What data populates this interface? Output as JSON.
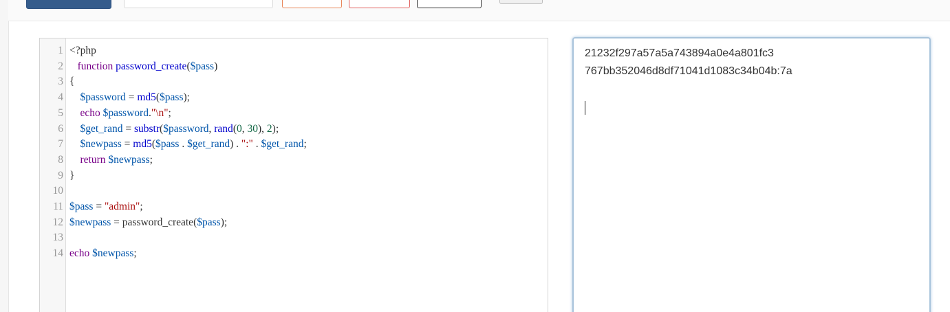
{
  "editor": {
    "lines": [
      {
        "n": "1",
        "tokens": [
          [
            "plain",
            "<?php"
          ]
        ]
      },
      {
        "n": "2",
        "tokens": [
          [
            "plain",
            "   "
          ],
          [
            "kw",
            "function"
          ],
          [
            "plain",
            " "
          ],
          [
            "fn",
            "password_create"
          ],
          [
            "plain",
            "("
          ],
          [
            "var",
            "$pass"
          ],
          [
            "plain",
            ")"
          ]
        ]
      },
      {
        "n": "3",
        "tokens": [
          [
            "plain",
            "{"
          ]
        ]
      },
      {
        "n": "4",
        "tokens": [
          [
            "plain",
            "    "
          ],
          [
            "var",
            "$password"
          ],
          [
            "plain",
            " = "
          ],
          [
            "fn",
            "md5"
          ],
          [
            "plain",
            "("
          ],
          [
            "var",
            "$pass"
          ],
          [
            "plain",
            ");"
          ]
        ]
      },
      {
        "n": "5",
        "tokens": [
          [
            "plain",
            "    "
          ],
          [
            "kw",
            "echo"
          ],
          [
            "plain",
            " "
          ],
          [
            "var",
            "$password"
          ],
          [
            "plain",
            "."
          ],
          [
            "str",
            "\"\\n\""
          ],
          [
            "plain",
            ";"
          ]
        ]
      },
      {
        "n": "6",
        "tokens": [
          [
            "plain",
            "    "
          ],
          [
            "var",
            "$get_rand"
          ],
          [
            "plain",
            " = "
          ],
          [
            "fn",
            "substr"
          ],
          [
            "plain",
            "("
          ],
          [
            "var",
            "$password"
          ],
          [
            "plain",
            ", "
          ],
          [
            "fn",
            "rand"
          ],
          [
            "plain",
            "("
          ],
          [
            "num",
            "0"
          ],
          [
            "plain",
            ", "
          ],
          [
            "num",
            "30"
          ],
          [
            "plain",
            "), "
          ],
          [
            "num",
            "2"
          ],
          [
            "plain",
            ");"
          ]
        ]
      },
      {
        "n": "7",
        "tokens": [
          [
            "plain",
            "    "
          ],
          [
            "var",
            "$newpass"
          ],
          [
            "plain",
            " = "
          ],
          [
            "fn",
            "md5"
          ],
          [
            "plain",
            "("
          ],
          [
            "var",
            "$pass"
          ],
          [
            "plain",
            " . "
          ],
          [
            "var",
            "$get_rand"
          ],
          [
            "plain",
            ") . "
          ],
          [
            "str",
            "\":\""
          ],
          [
            "plain",
            " . "
          ],
          [
            "var",
            "$get_rand"
          ],
          [
            "plain",
            ";"
          ]
        ]
      },
      {
        "n": "8",
        "tokens": [
          [
            "plain",
            "    "
          ],
          [
            "kw",
            "return"
          ],
          [
            "plain",
            " "
          ],
          [
            "var",
            "$newpass"
          ],
          [
            "plain",
            ";"
          ]
        ]
      },
      {
        "n": "9",
        "tokens": [
          [
            "plain",
            "}"
          ]
        ]
      },
      {
        "n": "10",
        "tokens": []
      },
      {
        "n": "11",
        "tokens": [
          [
            "var",
            "$pass"
          ],
          [
            "plain",
            " = "
          ],
          [
            "str",
            "\"admin\""
          ],
          [
            "plain",
            ";"
          ]
        ]
      },
      {
        "n": "12",
        "tokens": [
          [
            "var",
            "$newpass"
          ],
          [
            "plain",
            " = "
          ],
          [
            "plain",
            "password_create"
          ],
          [
            "plain",
            "("
          ],
          [
            "var",
            "$pass"
          ],
          [
            "plain",
            ");"
          ]
        ]
      },
      {
        "n": "13",
        "tokens": []
      },
      {
        "n": "14",
        "tokens": [
          [
            "kw",
            "echo"
          ],
          [
            "plain",
            " "
          ],
          [
            "var",
            "$newpass"
          ],
          [
            "plain",
            ";"
          ]
        ]
      }
    ]
  },
  "output": {
    "lines": [
      "21232f297a57a5a743894a0e4a801fc3",
      "767bb352046d8df71041d1083c34b04b:7a"
    ]
  },
  "colors": {
    "primary_button": "#355c8c",
    "output_focus_border": "#a8c3db"
  }
}
